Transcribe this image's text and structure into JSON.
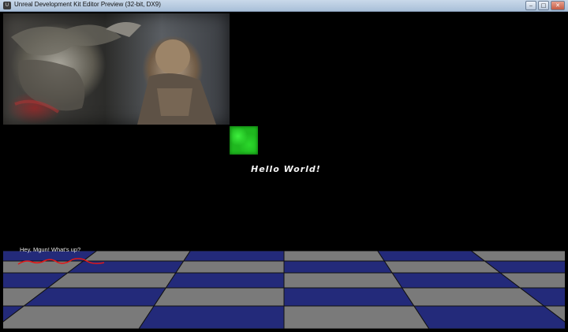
{
  "window": {
    "title": "Unreal Development Kit Editor Preview (32-bit, DX9)",
    "icon": "udk-app-icon",
    "controls": {
      "minimize": "‒",
      "maximize": "□",
      "close": "✕"
    }
  },
  "viewport": {
    "hello_text": "Hello World!",
    "subtitle_text": "Hey, Mgun! What's up?",
    "image_name": "game-artwork-image",
    "tile_color": "#1fb81f",
    "floor_colors": {
      "blue": "#232a7a",
      "gray": "#7a7a7a"
    },
    "squiggle_color": "#e01818"
  }
}
